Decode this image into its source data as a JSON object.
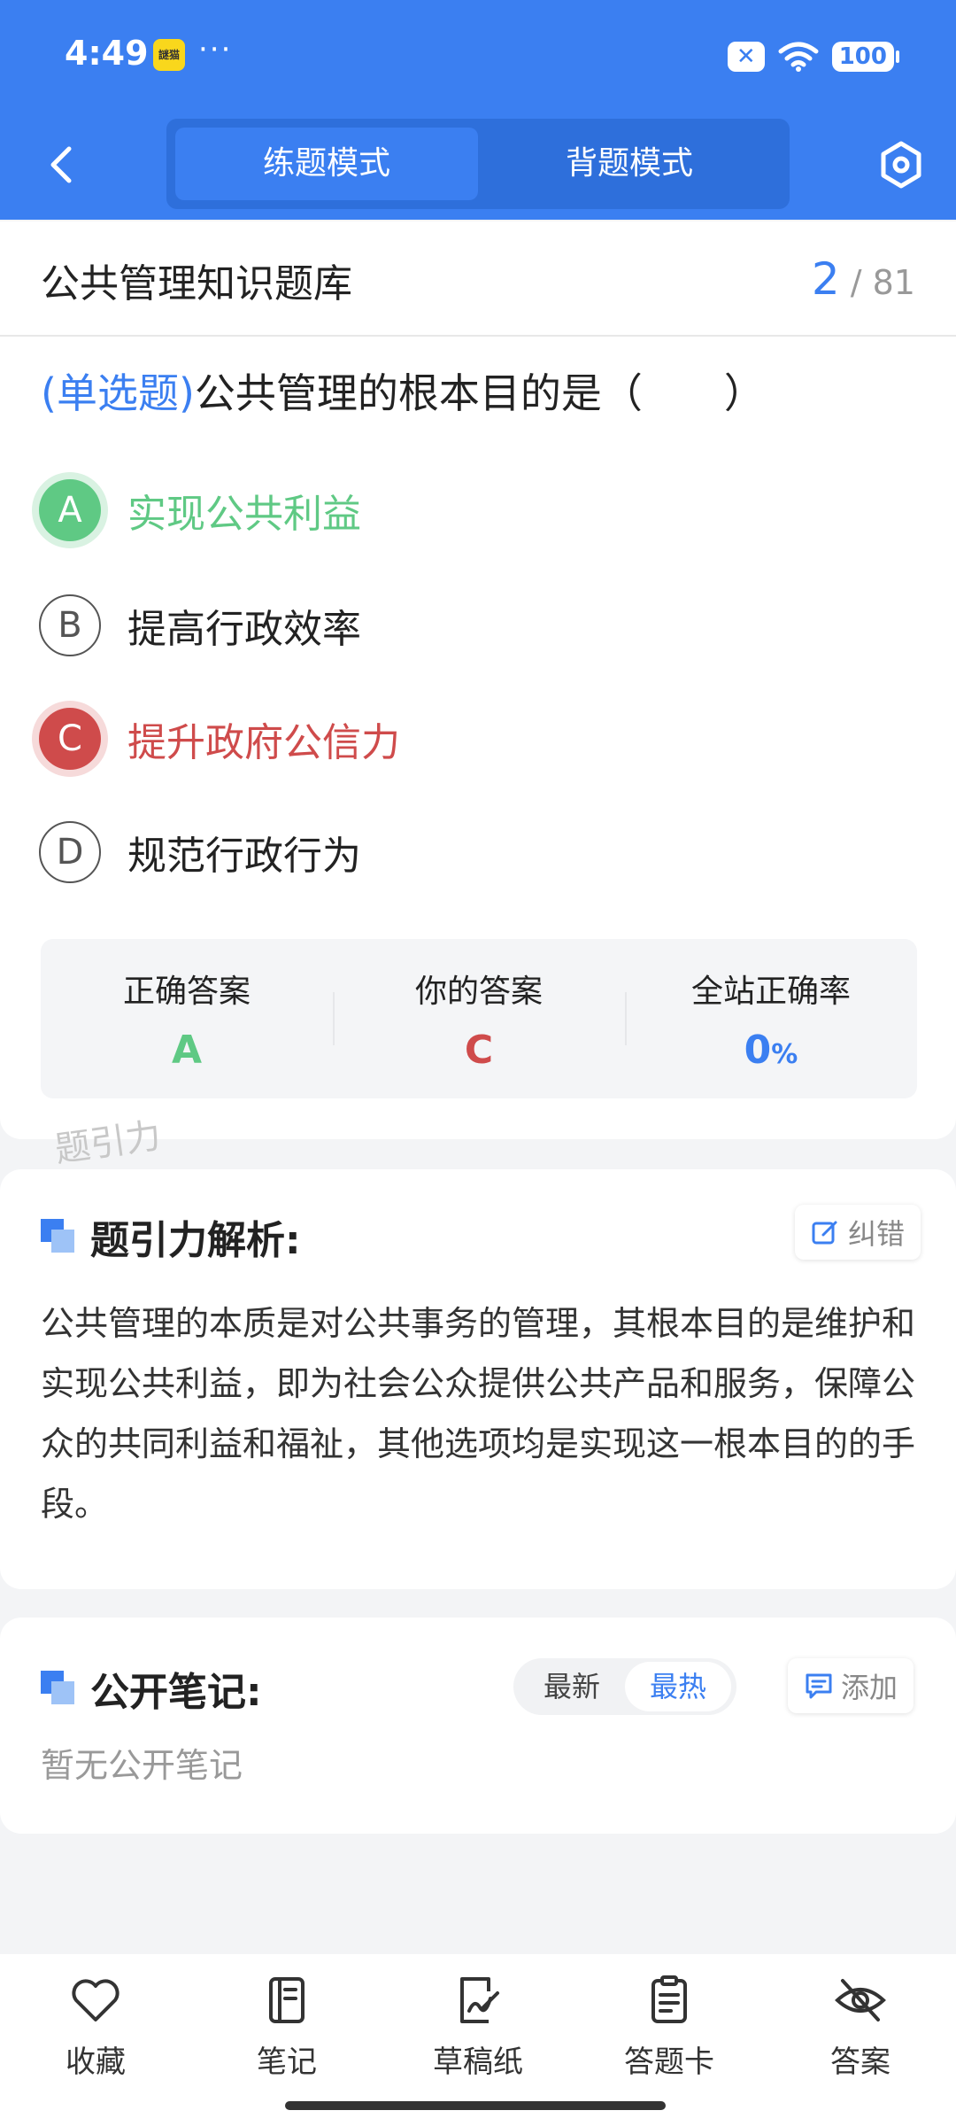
{
  "status_bar": {
    "time": "4:49",
    "app_badge_text": "謎猫",
    "dots": "···",
    "x_badge": "✕",
    "battery": "100"
  },
  "nav": {
    "modes": [
      "练题模式",
      "背题模式"
    ],
    "active_mode": "练题模式"
  },
  "question_card": {
    "bank_title": "公共管理知识题库",
    "progress_current": "2",
    "progress_total": "/ 81",
    "question_type": "(单选题)",
    "question_text": "公共管理的根本目的是（　　）",
    "options": [
      {
        "letter": "A",
        "text": "实现公共利益",
        "state": "correct"
      },
      {
        "letter": "B",
        "text": "提高行政效率",
        "state": "normal"
      },
      {
        "letter": "C",
        "text": "提升政府公信力",
        "state": "wrong"
      },
      {
        "letter": "D",
        "text": "规范行政行为",
        "state": "normal"
      }
    ],
    "stats": {
      "correct_label": "正确答案",
      "correct_value": "A",
      "yours_label": "你的答案",
      "yours_value": "C",
      "rate_label": "全站正确率",
      "rate_value": "0",
      "rate_unit": "%"
    },
    "watermark": "题引力"
  },
  "analysis": {
    "title": "题引力解析:",
    "correct_btn": "纠错",
    "text": "公共管理的本质是对公共事务的管理，其根本目的是维护和实现公共利益，即为社会公众提供公共产品和服务，保障公众的共同利益和福祉，其他选项均是实现这一根本目的的手段。"
  },
  "notes": {
    "title": "公开笔记:",
    "sort_latest": "最新",
    "sort_hot": "最热",
    "active_sort": "最热",
    "add_btn": "添加",
    "empty_text": "暂无公开笔记"
  },
  "bottom_bar": {
    "items": [
      {
        "label": "收藏",
        "icon": "heart-icon"
      },
      {
        "label": "笔记",
        "icon": "notebook-icon"
      },
      {
        "label": "草稿纸",
        "icon": "draft-icon"
      },
      {
        "label": "答题卡",
        "icon": "clipboard-icon"
      },
      {
        "label": "答案",
        "icon": "eye-off-icon"
      }
    ]
  },
  "colors": {
    "primary": "#3b7ff1",
    "correct": "#5fc984",
    "wrong": "#cf4b4b"
  }
}
